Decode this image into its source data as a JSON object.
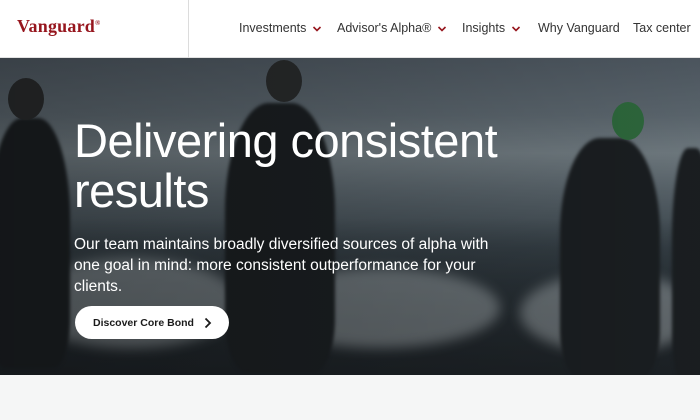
{
  "brand": {
    "logo_text": "Vanguard",
    "logo_mark": "®",
    "brand_color": "#96151d"
  },
  "nav": {
    "items": [
      {
        "label": "Investments",
        "has_dropdown": true
      },
      {
        "label": "Advisor's Alpha®",
        "has_dropdown": true
      },
      {
        "label": "Insights",
        "has_dropdown": true
      },
      {
        "label": "Why Vanguard",
        "has_dropdown": false
      },
      {
        "label": "Tax center",
        "has_dropdown": false
      }
    ],
    "chevron_icon": "chevron-down-icon",
    "chevron_color": "#96151d"
  },
  "hero": {
    "headline": "Delivering consistent results",
    "subtext": "Our team maintains broadly diversified sources of alpha with one goal in mind: more consistent outperformance for your clients.",
    "cta_label": "Discover Core Bond",
    "cta_icon": "chevron-right-icon"
  }
}
